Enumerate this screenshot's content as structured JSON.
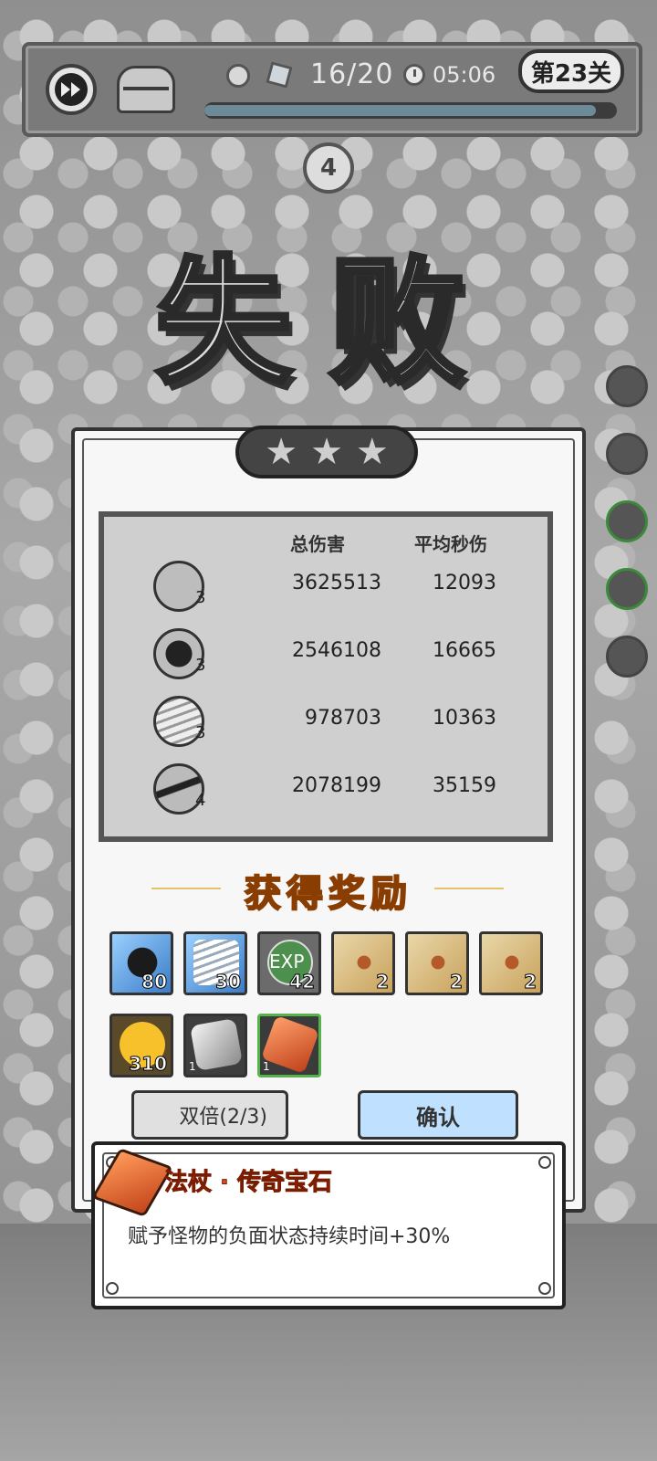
{
  "hud": {
    "wave_count": "16/20",
    "timer": "05:06",
    "level": "第23关",
    "progress": 0.95
  },
  "wave_number": "4",
  "result_title": "失败",
  "stars": [
    "★",
    "★",
    "★"
  ],
  "stats": {
    "header_damage": "总伤害",
    "header_dps": "平均秒伤",
    "rows": [
      {
        "level": "3",
        "damage": "3625513",
        "dps": "12093"
      },
      {
        "level": "3",
        "damage": "2546108",
        "dps": "16665"
      },
      {
        "level": "3",
        "damage": "978703",
        "dps": "10363"
      },
      {
        "level": "4",
        "damage": "2078199",
        "dps": "35159"
      }
    ]
  },
  "rewards": {
    "title": "获得奖励",
    "items": [
      {
        "icon": "bomb-gem-icon",
        "count": "80"
      },
      {
        "icon": "drill-gem-icon",
        "count": "30"
      },
      {
        "icon": "exp-icon",
        "label": "EXP",
        "count": "42"
      },
      {
        "icon": "scroll-icon",
        "count": "2"
      },
      {
        "icon": "scroll-icon",
        "count": "2"
      },
      {
        "icon": "scroll-icon",
        "count": "2"
      },
      {
        "icon": "gold-coin-icon",
        "count": "310"
      },
      {
        "icon": "stone-icon",
        "count": "1"
      },
      {
        "icon": "orange-gem-icon",
        "count": "1"
      }
    ]
  },
  "buttons": {
    "double": "双倍(2/3)",
    "confirm": "确认"
  },
  "tooltip": {
    "title": "法杖 · 传奇宝石",
    "description": "赋予怪物的负面状态持续时间+30%"
  }
}
